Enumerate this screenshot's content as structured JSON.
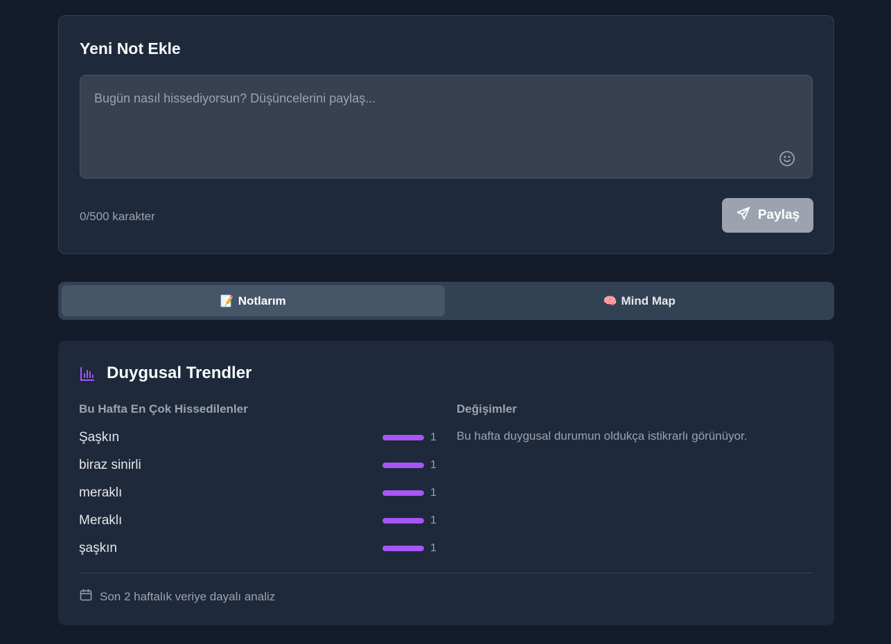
{
  "composer": {
    "title": "Yeni Not Ekle",
    "placeholder": "Bugün nasıl hissediyorsun? Düşüncelerini paylaş...",
    "value": "",
    "char_count": "0/500 karakter",
    "emoji_icon": "smiley-face-icon",
    "share_label": "Paylaş",
    "share_icon": "send-icon",
    "share_bg": "#9ca3af"
  },
  "tabs": [
    {
      "emoji": "📝",
      "label": "Notlarım",
      "active": true
    },
    {
      "emoji": "🧠",
      "label": "Mind Map",
      "active": false
    }
  ],
  "trends": {
    "icon": "bar-chart-icon",
    "title": "Duygusal Trendler",
    "accent": "#a855f7",
    "left_heading": "Bu Hafta En Çok Hissedilenler",
    "right_heading": "Değişimler",
    "emotions": [
      {
        "name": "Şaşkın",
        "count": "1",
        "fill": 1.0
      },
      {
        "name": "biraz sinirli",
        "count": "1",
        "fill": 1.0
      },
      {
        "name": "meraklı",
        "count": "1",
        "fill": 1.0
      },
      {
        "name": "Meraklı",
        "count": "1",
        "fill": 1.0
      },
      {
        "name": "şaşkın",
        "count": "1",
        "fill": 1.0
      }
    ],
    "change_text": "Bu hafta duygusal durumun oldukça istikrarlı görünüyor.",
    "footer_icon": "calendar-icon",
    "footer_text": "Son 2 haftalık veriye dayalı analiz"
  }
}
